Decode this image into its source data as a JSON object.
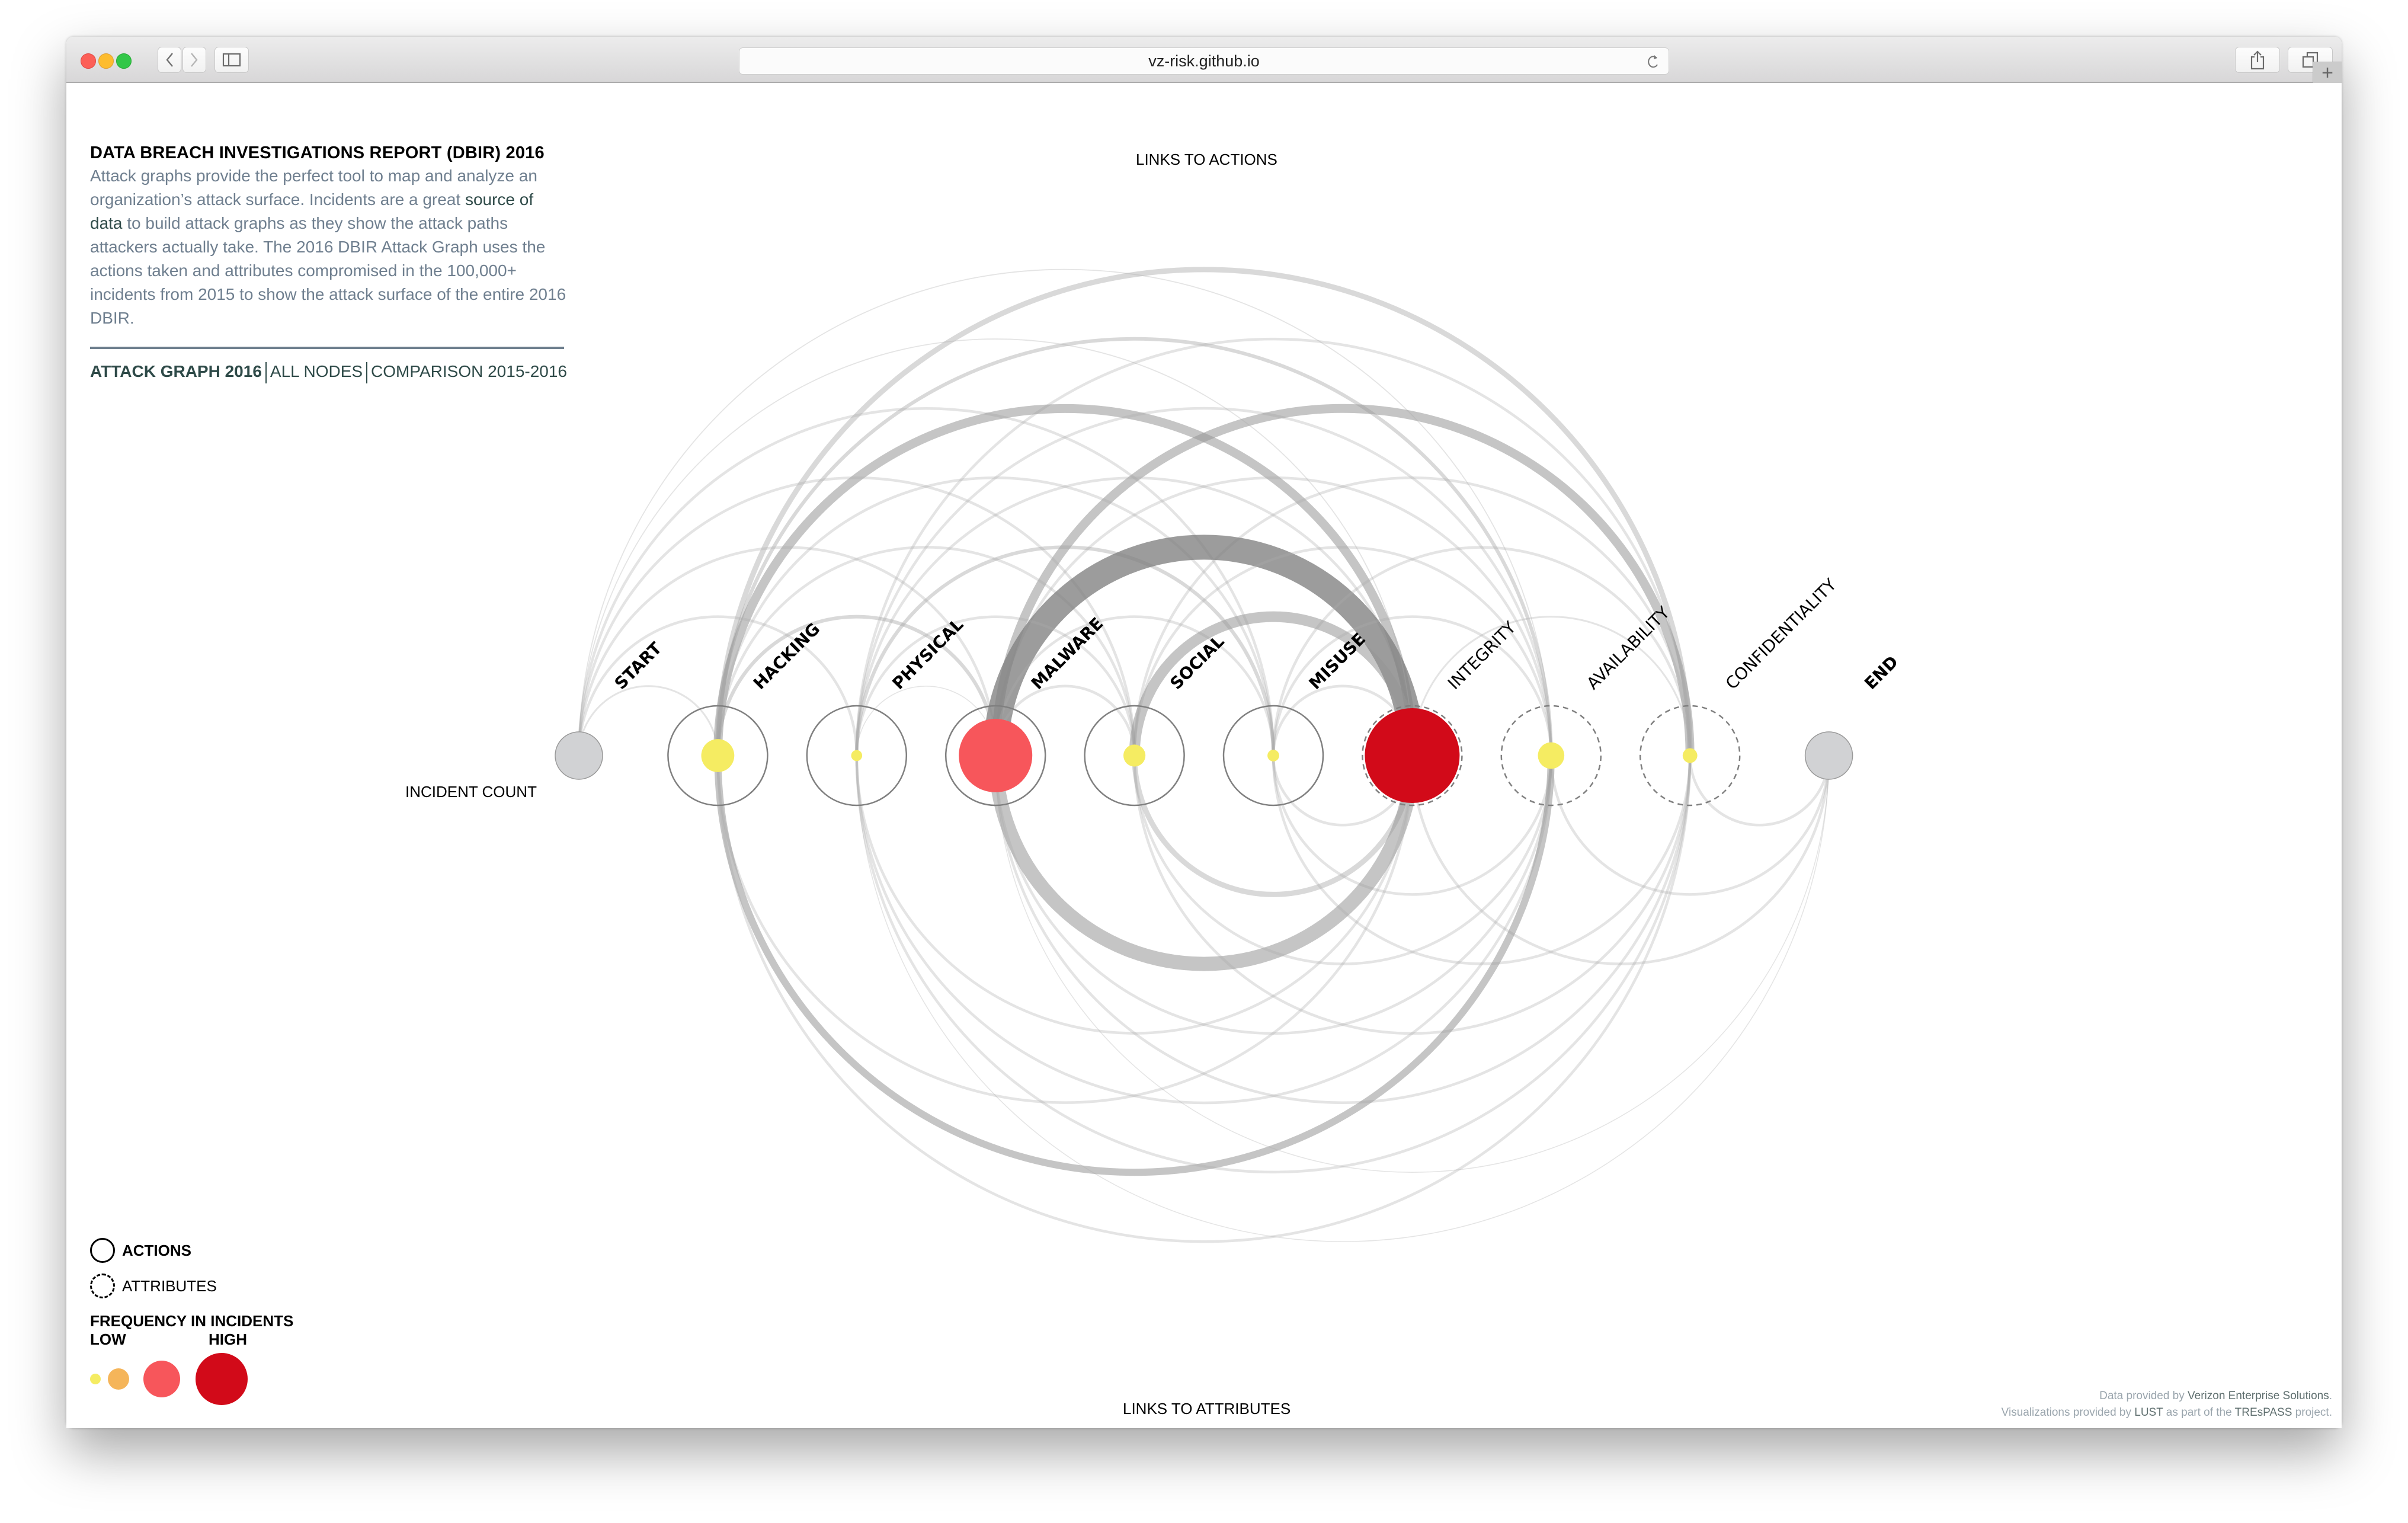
{
  "browser": {
    "url": "vz-risk.github.io",
    "back_icon": "chevron-left-icon",
    "forward_icon": "chevron-right-icon",
    "sidebar_icon": "sidebar-icon",
    "reload_icon": "reload-icon",
    "share_icon": "share-icon",
    "tabs_icon": "tabs-icon",
    "new_tab_label": "+"
  },
  "intro": {
    "title": "DATA BREACH INVESTIGATIONS REPORT (DBIR) 2016",
    "text_before": "Attack graphs provide the perfect tool to map and analyze an organization’s attack surface. Incidents are a great ",
    "link_text": "source of data",
    "text_after": " to build attack graphs as they show the attack paths attackers actually take. The 2016 DBIR Attack Graph uses the actions taken and attributes compromised in the 100,000+ incidents from 2015 to show the attack surface of the entire 2016 DBIR."
  },
  "nav": {
    "items": [
      {
        "label": "ATTACK GRAPH 2016",
        "active": true
      },
      {
        "label": "ALL NODES",
        "active": false
      },
      {
        "label": "COMPARISON 2015-2016",
        "active": false
      }
    ]
  },
  "graph": {
    "top_label": "LINKS TO ACTIONS",
    "bottom_label": "LINKS TO ATTRIBUTES",
    "row_label": "INCIDENT COUNT",
    "colors": {
      "low": "#f5ec62",
      "medium_low": "#f5b55a",
      "medium_high": "#f7565b",
      "high": "#d20a19",
      "endpoint": "#d1d2d4",
      "link": "#9a9a9a"
    },
    "nodes": [
      {
        "id": "start",
        "label": "START",
        "type": "endpoint",
        "frequency": "endpoint",
        "size": 0.65
      },
      {
        "id": "hacking",
        "label": "HACKING",
        "type": "action",
        "frequency": "low",
        "size": 0.45
      },
      {
        "id": "physical",
        "label": "PHYSICAL",
        "type": "action",
        "frequency": "low",
        "size": 0.15
      },
      {
        "id": "malware",
        "label": "MALWARE",
        "type": "action",
        "frequency": "medium_high",
        "size": 1.0
      },
      {
        "id": "social",
        "label": "SOCIAL",
        "type": "action",
        "frequency": "low",
        "size": 0.3
      },
      {
        "id": "misuse",
        "label": "MISUSE",
        "type": "action",
        "frequency": "low",
        "size": 0.16
      },
      {
        "id": "integrity",
        "label": "INTEGRITY",
        "type": "attribute",
        "frequency": "high",
        "size": 1.3
      },
      {
        "id": "availability",
        "label": "AVAILABILITY",
        "type": "attribute",
        "frequency": "low",
        "size": 0.36
      },
      {
        "id": "confidentiality",
        "label": "CONFIDENTIALITY",
        "type": "attribute",
        "frequency": "low",
        "size": 0.2
      },
      {
        "id": "end",
        "label": "END",
        "type": "endpoint",
        "frequency": "endpoint",
        "size": 0.65
      }
    ],
    "links_to_actions": [
      {
        "from": "hacking",
        "to": "confidentiality",
        "weight": 3
      },
      {
        "from": "hacking",
        "to": "availability",
        "weight": 2
      },
      {
        "from": "physical",
        "to": "confidentiality",
        "weight": 1.5
      },
      {
        "from": "start",
        "to": "misuse",
        "weight": 1.5
      },
      {
        "from": "hacking",
        "to": "integrity",
        "weight": 5
      },
      {
        "from": "physical",
        "to": "availability",
        "weight": 1.5
      },
      {
        "from": "malware",
        "to": "confidentiality",
        "weight": 5
      },
      {
        "from": "start",
        "to": "social",
        "weight": 1.5
      },
      {
        "from": "hacking",
        "to": "misuse",
        "weight": 1.5
      },
      {
        "from": "physical",
        "to": "integrity",
        "weight": 1.5
      },
      {
        "from": "malware",
        "to": "availability",
        "weight": 1.5
      },
      {
        "from": "social",
        "to": "confidentiality",
        "weight": 1.5
      },
      {
        "from": "start",
        "to": "malware",
        "weight": 1.5
      },
      {
        "from": "hacking",
        "to": "social",
        "weight": 1.5
      },
      {
        "from": "physical",
        "to": "misuse",
        "weight": 2
      },
      {
        "from": "malware",
        "to": "integrity",
        "weight": 14
      },
      {
        "from": "social",
        "to": "availability",
        "weight": 1.5
      },
      {
        "from": "misuse",
        "to": "confidentiality",
        "weight": 1.5
      },
      {
        "from": "start",
        "to": "physical",
        "weight": 1.5
      },
      {
        "from": "hacking",
        "to": "malware",
        "weight": 2
      },
      {
        "from": "physical",
        "to": "social",
        "weight": 1.5
      },
      {
        "from": "malware",
        "to": "misuse",
        "weight": 1.5
      },
      {
        "from": "social",
        "to": "integrity",
        "weight": 6
      },
      {
        "from": "misuse",
        "to": "availability",
        "weight": 1.5
      },
      {
        "from": "start",
        "to": "hacking",
        "weight": 1
      },
      {
        "from": "malware",
        "to": "social",
        "weight": 1.5
      },
      {
        "from": "misuse",
        "to": "integrity",
        "weight": 1.5
      },
      {
        "from": "start",
        "to": "availability",
        "weight": 0.6
      },
      {
        "from": "start",
        "to": "integrity",
        "weight": 0.6
      },
      {
        "from": "physical",
        "to": "malware",
        "weight": 0.5
      },
      {
        "from": "integrity",
        "to": "confidentiality",
        "weight": 1
      }
    ],
    "links_to_attributes": [
      {
        "from": "misuse",
        "to": "integrity",
        "weight": 1.5
      },
      {
        "from": "confidentiality",
        "to": "end",
        "weight": 1.5
      },
      {
        "from": "social",
        "to": "integrity",
        "weight": 3
      },
      {
        "from": "misuse",
        "to": "availability",
        "weight": 1.5
      },
      {
        "from": "availability",
        "to": "end",
        "weight": 1.5
      },
      {
        "from": "malware",
        "to": "integrity",
        "weight": 8
      },
      {
        "from": "social",
        "to": "availability",
        "weight": 1.5
      },
      {
        "from": "misuse",
        "to": "confidentiality",
        "weight": 1.5
      },
      {
        "from": "integrity",
        "to": "end",
        "weight": 1.5
      },
      {
        "from": "physical",
        "to": "integrity",
        "weight": 1.5
      },
      {
        "from": "malware",
        "to": "availability",
        "weight": 1.5
      },
      {
        "from": "social",
        "to": "confidentiality",
        "weight": 1.5
      },
      {
        "from": "hacking",
        "to": "integrity",
        "weight": 1.5
      },
      {
        "from": "physical",
        "to": "availability",
        "weight": 1.5
      },
      {
        "from": "malware",
        "to": "confidentiality",
        "weight": 1.5
      },
      {
        "from": "hacking",
        "to": "availability",
        "weight": 4
      },
      {
        "from": "physical",
        "to": "confidentiality",
        "weight": 1.5
      },
      {
        "from": "hacking",
        "to": "confidentiality",
        "weight": 1.5
      },
      {
        "from": "physical",
        "to": "end",
        "weight": 0.5
      },
      {
        "from": "malware",
        "to": "end",
        "weight": 0.5
      }
    ]
  },
  "legend": {
    "actions_label": "ACTIONS",
    "attributes_label": "ATTRIBUTES",
    "frequency_title": "FREQUENCY IN INCIDENTS",
    "low_label": "LOW",
    "high_label": "HIGH",
    "scale": [
      "low",
      "medium_low",
      "medium_high",
      "high"
    ]
  },
  "credits": {
    "line1_prefix": "Data provided by ",
    "line1_strong": "Verizon Enterprise Solutions",
    "line1_suffix": ".",
    "line2_prefix": "Visualizations provided by ",
    "line2_strong1": "LUST",
    "line2_mid": " as part of the ",
    "line2_strong2": "TREsPASS",
    "line2_suffix": " project."
  }
}
